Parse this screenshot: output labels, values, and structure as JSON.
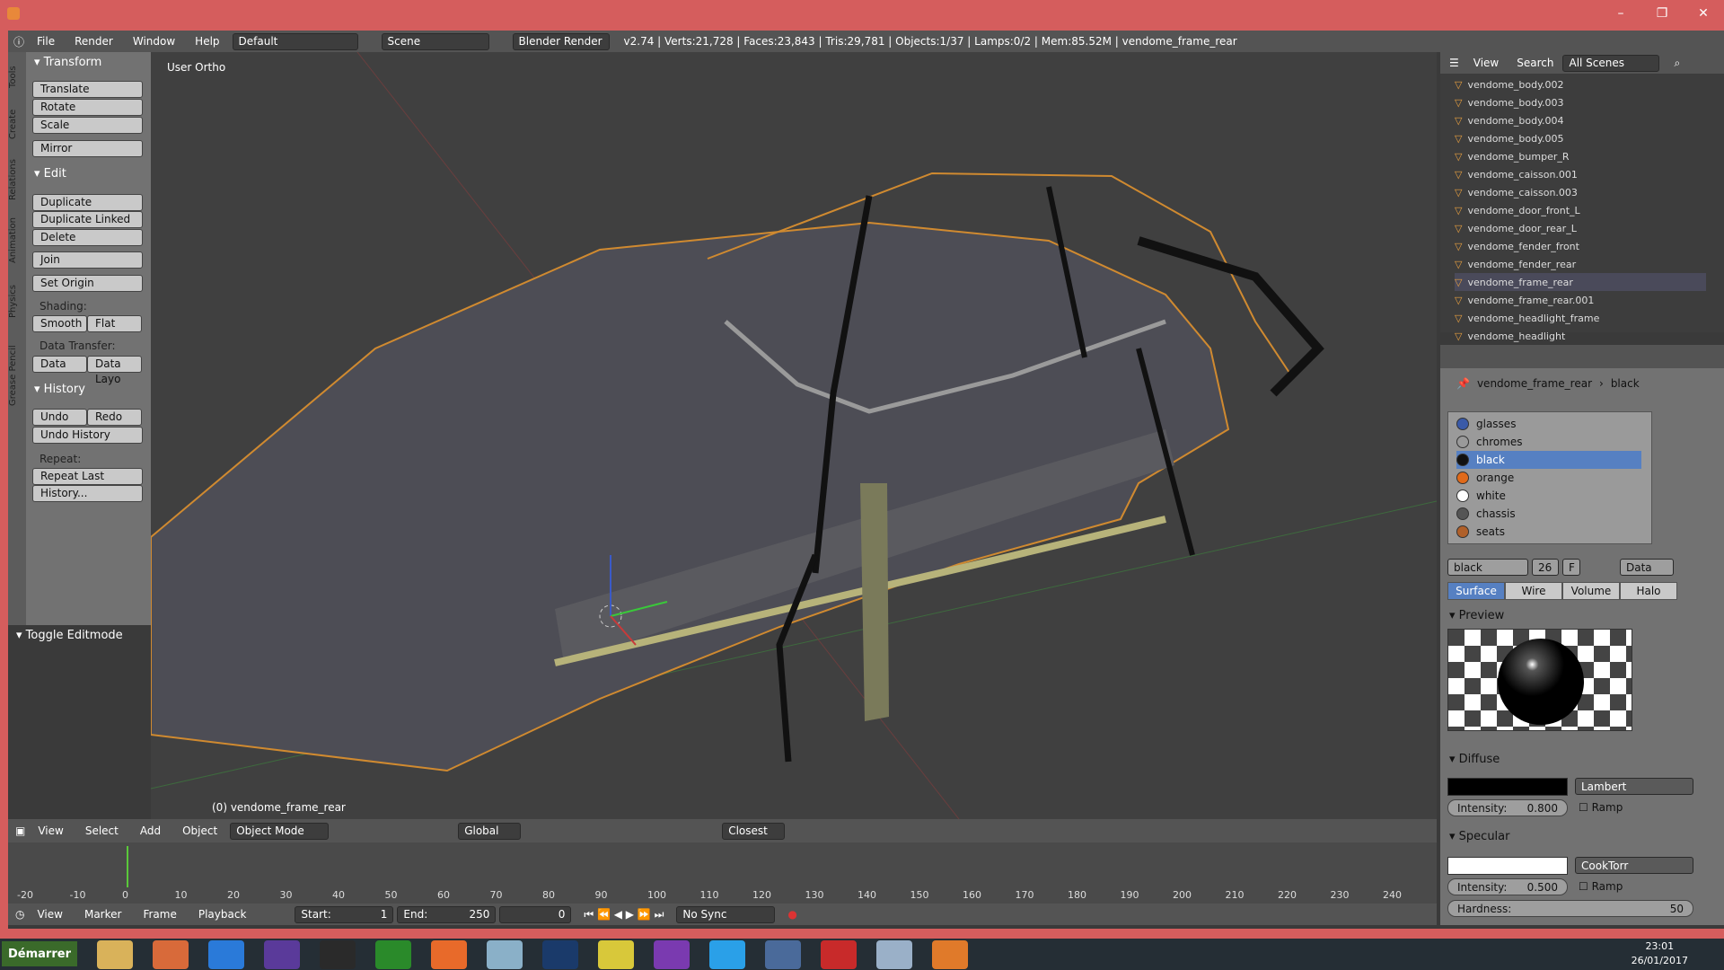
{
  "window": {
    "min": "–",
    "max": "❐",
    "close": "✕"
  },
  "top": {
    "menus": [
      "File",
      "Render",
      "Window",
      "Help"
    ],
    "layout": "Default",
    "scene": "Scene",
    "engine": "Blender Render",
    "info": "v2.74 | Verts:21,728 | Faces:23,843 | Tris:29,781 | Objects:1/37 | Lamps:0/2 | Mem:85.52M | vendome_frame_rear"
  },
  "tools": {
    "tabs": [
      "Tools",
      "Create",
      "Relations",
      "Animation",
      "Physics",
      "Grease Pencil"
    ],
    "transform": {
      "title": "Transform",
      "translate": "Translate",
      "rotate": "Rotate",
      "scale": "Scale",
      "mirror": "Mirror"
    },
    "edit": {
      "title": "Edit",
      "duplicate": "Duplicate",
      "duplicate_linked": "Duplicate Linked",
      "delete": "Delete",
      "join": "Join",
      "set_origin": "Set Origin",
      "shading": "Shading:",
      "smooth": "Smooth",
      "flat": "Flat",
      "data_transfer": "Data Transfer:",
      "data": "Data",
      "data_layo": "Data Layo"
    },
    "history": {
      "title": "History",
      "undo": "Undo",
      "redo": "Redo",
      "undo_history": "Undo History",
      "repeat": "Repeat:",
      "repeat_last": "Repeat Last",
      "history": "History..."
    },
    "toggle_editmode": "Toggle Editmode"
  },
  "viewport": {
    "label": "User Ortho",
    "object_label": "(0) vendome_frame_rear"
  },
  "view_header": {
    "menus": [
      "View",
      "Select",
      "Add",
      "Object"
    ],
    "mode": "Object Mode",
    "orientation": "Global",
    "snap": "Closest"
  },
  "timeline": {
    "menus": [
      "View",
      "Marker",
      "Frame",
      "Playback"
    ],
    "start": "Start:",
    "start_val": "1",
    "end": "End:",
    "end_val": "250",
    "current": "0",
    "sync": "No Sync",
    "ticks": [
      "-20",
      "-10",
      "0",
      "10",
      "20",
      "30",
      "40",
      "50",
      "60",
      "70",
      "80",
      "90",
      "100",
      "110",
      "120",
      "130",
      "140",
      "150",
      "160",
      "170",
      "180",
      "190",
      "200",
      "210",
      "220",
      "230",
      "240"
    ]
  },
  "outliner": {
    "view": "View",
    "search": "Search",
    "scenes": "All Scenes",
    "items": [
      "vendome_body.002",
      "vendome_body.003",
      "vendome_body.004",
      "vendome_body.005",
      "vendome_bumper_R",
      "vendome_caisson.001",
      "vendome_caisson.003",
      "vendome_door_front_L",
      "vendome_door_rear_L",
      "vendome_fender_front",
      "vendome_fender_rear",
      "vendome_frame_rear",
      "vendome_frame_rear.001",
      "vendome_headlight_frame",
      "vendome_headlight"
    ]
  },
  "properties": {
    "breadcrumb_obj": "vendome_frame_rear",
    "breadcrumb_mat": "black",
    "materials": [
      {
        "name": "glasses",
        "color": "#3a5aa8"
      },
      {
        "name": "chromes",
        "color": "#9a9a9a"
      },
      {
        "name": "black",
        "color": "#111111"
      },
      {
        "name": "orange",
        "color": "#e06a1a"
      },
      {
        "name": "white",
        "color": "#ffffff"
      },
      {
        "name": "chassis",
        "color": "#555555"
      },
      {
        "name": "seats",
        "color": "#b0602a"
      }
    ],
    "mat_name": "black",
    "users": "26",
    "fake": "F",
    "link": "Data",
    "tabs": [
      "Surface",
      "Wire",
      "Volume",
      "Halo"
    ],
    "preview": "Preview",
    "diffuse": "Diffuse",
    "diffuse_shader": "Lambert",
    "intensity_label": "Intensity:",
    "diffuse_intensity": "0.800",
    "ramp": "Ramp",
    "specular": "Specular",
    "specular_shader": "CookTorr",
    "specular_intensity": "0.500",
    "hardness_label": "Hardness:",
    "hardness": "50"
  },
  "taskbar": {
    "start": "Démarrer",
    "time": "23:01",
    "date": "26/01/2017"
  }
}
